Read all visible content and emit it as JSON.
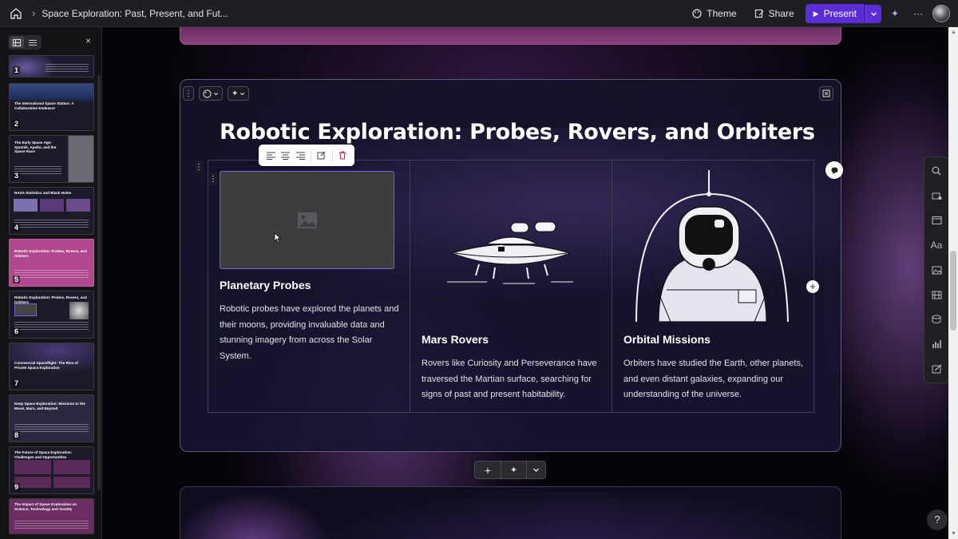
{
  "topbar": {
    "doc_title": "Space Exploration: Past, Present, and Fut...",
    "theme_label": "Theme",
    "share_label": "Share",
    "present_label": "Present",
    "accent": "#5b2dd6"
  },
  "sidebar": {
    "thumbnails": [
      {
        "num": "1",
        "title": ""
      },
      {
        "num": "2",
        "title": "The International Space Station: A Collaborative Endeavor"
      },
      {
        "num": "3",
        "title": "The Early Space Age: Sputnik, Apollo, and the Space Race"
      },
      {
        "num": "4",
        "title": "NASA Statistics and Black Holes"
      },
      {
        "num": "5",
        "title": "Robotic Exploration: Probes, Rovers, and Orbiters"
      },
      {
        "num": "6",
        "title": "Robotic Exploration: Probes, Rovers, and Orbiters"
      },
      {
        "num": "7",
        "title": "Commercial Spaceflight: The Rise of Private Space Exploration"
      },
      {
        "num": "8",
        "title": "Deep Space Exploration: Missions to the Moon, Mars, and Beyond"
      },
      {
        "num": "9",
        "title": "The Future of Space Exploration: Challenges and Opportunities"
      },
      {
        "num": "",
        "title": "The Impact of Space Exploration on Science, Technology and Society"
      }
    ],
    "selected": "5"
  },
  "slide": {
    "title": "Robotic Exploration: Probes, Rovers, and Orbiters",
    "columns": [
      {
        "heading": "Planetary Probes",
        "body": "Robotic probes have explored the planets and their moons, providing invaluable data and stunning imagery from across the Solar System.",
        "image": "image-placeholder-icon"
      },
      {
        "heading": "Mars Rovers",
        "body": "Rovers like Curiosity and Perseverance have traversed the Martian surface, searching for signs of past and present habitability.",
        "image": "spaceship-illustration"
      },
      {
        "heading": "Orbital Missions",
        "body": "Orbiters have studied the Earth, other planets, and even distant galaxies, expanding our understanding of the universe.",
        "image": "astronaut-illustration"
      }
    ]
  },
  "help_label": "?"
}
